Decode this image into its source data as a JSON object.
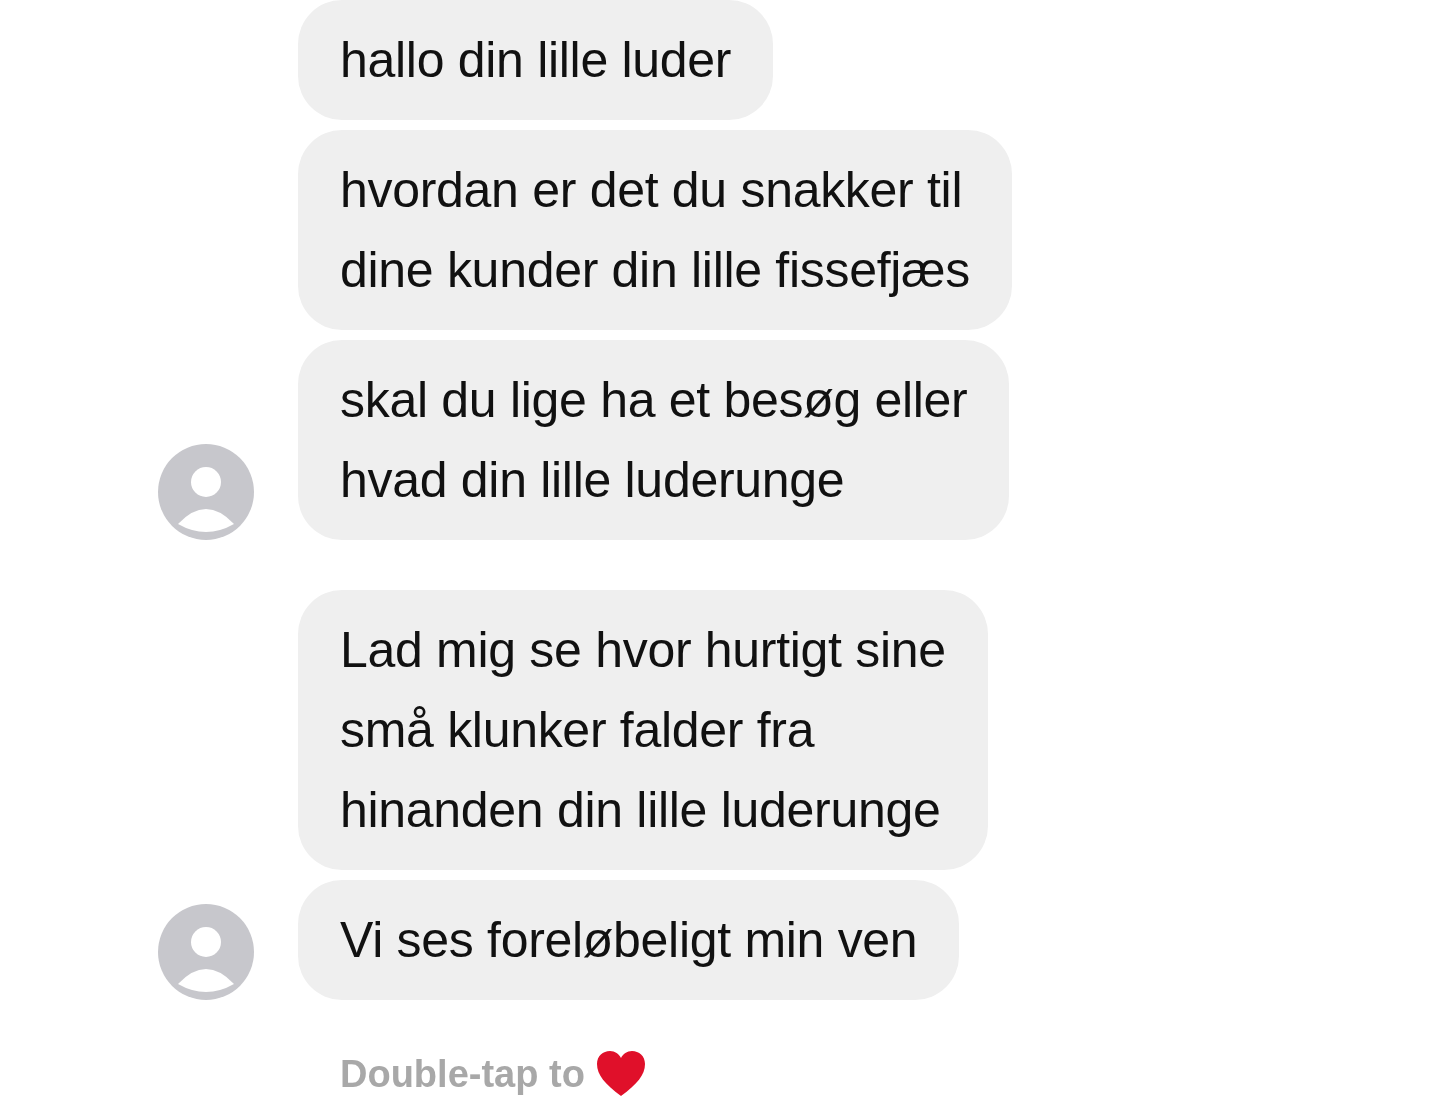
{
  "groups": [
    {
      "messages": [
        {
          "text": "hallo din lille luder",
          "avatar": false
        },
        {
          "text": "hvordan er det du snakker til\ndine kunder din lille fissefjæs",
          "avatar": false
        },
        {
          "text": "skal du lige ha et besøg eller\nhvad din lille luderunge",
          "avatar": true
        }
      ]
    },
    {
      "messages": [
        {
          "text": "Lad mig se hvor hurtigt sine\nsmå klunker falder fra\nhinanden din lille luderunge",
          "avatar": false
        },
        {
          "text": "Vi ses foreløbeligt min ven",
          "avatar": true
        }
      ]
    }
  ],
  "hint": {
    "text": "Double-tap to"
  }
}
